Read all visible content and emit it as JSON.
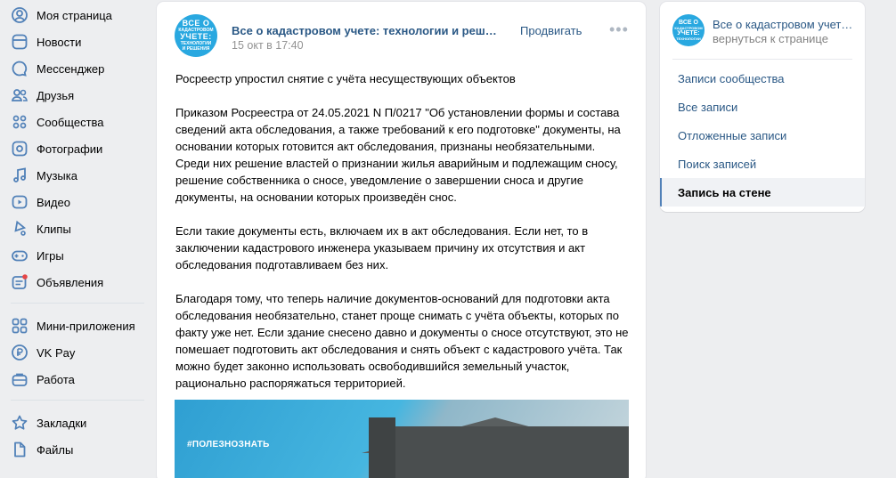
{
  "sidebar": {
    "items": [
      {
        "label": "Моя страница",
        "icon": "user-circle-icon"
      },
      {
        "label": "Новости",
        "icon": "news-icon"
      },
      {
        "label": "Мессенджер",
        "icon": "message-icon"
      },
      {
        "label": "Друзья",
        "icon": "friends-icon"
      },
      {
        "label": "Сообщества",
        "icon": "communities-icon"
      },
      {
        "label": "Фотографии",
        "icon": "photo-icon"
      },
      {
        "label": "Музыка",
        "icon": "music-icon"
      },
      {
        "label": "Видео",
        "icon": "video-icon"
      },
      {
        "label": "Клипы",
        "icon": "clips-icon"
      },
      {
        "label": "Игры",
        "icon": "gamepad-icon"
      },
      {
        "label": "Объявления",
        "icon": "classifieds-icon"
      },
      {
        "label": "Мини-приложения",
        "icon": "apps-icon"
      },
      {
        "label": "VK Pay",
        "icon": "vkpay-icon"
      },
      {
        "label": "Работа",
        "icon": "briefcase-icon"
      },
      {
        "label": "Закладки",
        "icon": "star-icon"
      },
      {
        "label": "Файлы",
        "icon": "file-icon"
      }
    ]
  },
  "post": {
    "avatar_text": {
      "line1": "ВСЕ О",
      "line2": "КАДАСТРОВОМ",
      "line3": "УЧЕТЕ:",
      "line4": "ТЕХНОЛОГИИ",
      "line5": "И РЕШЕНИЯ"
    },
    "author": "Все о кадастровом учете: технологии и решения",
    "date": "15 окт в 17:40",
    "promote_label": "Продвигать",
    "more_label": "•••",
    "paragraphs": [
      "Росреестр упростил снятие с учёта несуществующих объектов",
      "Приказом Росреестра от 24.05.2021 N П/0217 \"Об установлении формы и состава сведений акта обследования, а также требований к его подготовке\" документы, на основании которых готовится акт обследования, признаны необязательными. Среди них решение властей о признании жилья аварийным и подлежащим сносу, решение собственника о сносе, уведомление о завершении сноса и другие документы, на основании которых произведён снос.",
      "Если такие документы есть, включаем их в акт обследования. Если нет, то в заключении кадастрового инженера указываем причину их отсутствия и акт обследования подготавливаем без них.",
      "Благодаря тому, что теперь наличие документов-оснований для подготовки акта обследования необязательно, станет проще снимать с учёта объекты, которых по факту уже нет. Если здание снесено давно и документы о сносе отсутствуют, это не помешает подготовить акт обследования и снять объект с кадастрового учёта. Так можно будет законно использовать освободившийся земельный участок, рационально распоряжаться территорией."
    ],
    "image_tag": "#ПОЛЕЗНОЗНАТЬ"
  },
  "right_panel": {
    "title": "Все о кадастровом учете: технологии и решения",
    "back_label": "вернуться к странице",
    "links": [
      {
        "label": "Записи сообщества",
        "active": false
      },
      {
        "label": "Все записи",
        "active": false
      },
      {
        "label": "Отложенные записи",
        "active": false
      },
      {
        "label": "Поиск записей",
        "active": false
      },
      {
        "label": "Запись на стене",
        "active": true
      }
    ]
  },
  "colors": {
    "accent": "#2a5885",
    "icon": "#5181b8",
    "avatar_bg": "#29a8e0",
    "page_bg": "#edeef0"
  }
}
